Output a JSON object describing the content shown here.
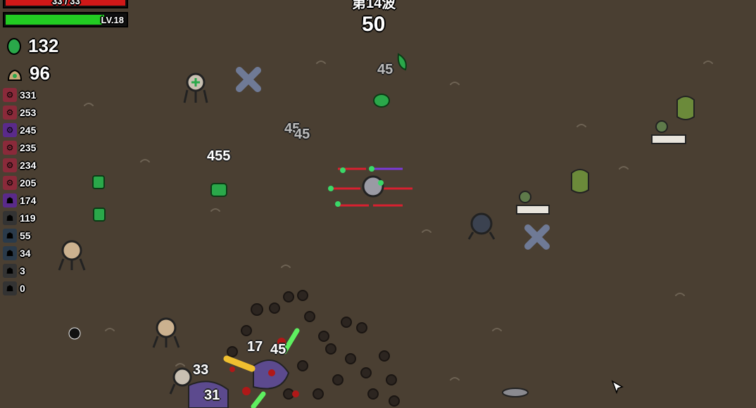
{
  "hud": {
    "health_text": "33 / 33",
    "level_text": "LV.18",
    "materials": "132",
    "bag": "96",
    "wave_title": "第14波",
    "wave_timer": "50"
  },
  "weapons": [
    {
      "icon": "weapon-icon-1",
      "value": "331",
      "color": "#8a2a3a"
    },
    {
      "icon": "weapon-icon-2",
      "value": "253",
      "color": "#8a2a3a"
    },
    {
      "icon": "weapon-icon-3",
      "value": "245",
      "color": "#5a2a8a"
    },
    {
      "icon": "weapon-icon-4",
      "value": "235",
      "color": "#8a2a3a"
    },
    {
      "icon": "weapon-icon-5",
      "value": "234",
      "color": "#8a2a3a"
    },
    {
      "icon": "weapon-icon-6",
      "value": "205",
      "color": "#8a2a3a"
    },
    {
      "icon": "weapon-icon-7",
      "value": "174",
      "color": "#5a2a8a"
    },
    {
      "icon": "weapon-icon-8",
      "value": "119",
      "color": "#333333"
    },
    {
      "icon": "weapon-icon-9",
      "value": "55",
      "color": "#2a3a4a"
    },
    {
      "icon": "weapon-icon-10",
      "value": "34",
      "color": "#2a3a4a"
    },
    {
      "icon": "weapon-icon-11",
      "value": "3",
      "color": "#333333"
    },
    {
      "icon": "weapon-icon-12",
      "value": "0",
      "color": "#333333"
    }
  ],
  "damage_numbers": [
    {
      "text": "45",
      "style": "grey"
    },
    {
      "text": "45",
      "style": "grey"
    },
    {
      "text": "45",
      "style": "grey"
    },
    {
      "text": "455",
      "style": "white"
    },
    {
      "text": "17",
      "style": "white"
    },
    {
      "text": "45",
      "style": "white"
    },
    {
      "text": "33",
      "style": "white"
    },
    {
      "text": "31",
      "style": "white"
    }
  ],
  "colors": {
    "ground": "#4a3f32",
    "health": "#d01818",
    "xp": "#22cc22",
    "material": "#2aa84a"
  }
}
